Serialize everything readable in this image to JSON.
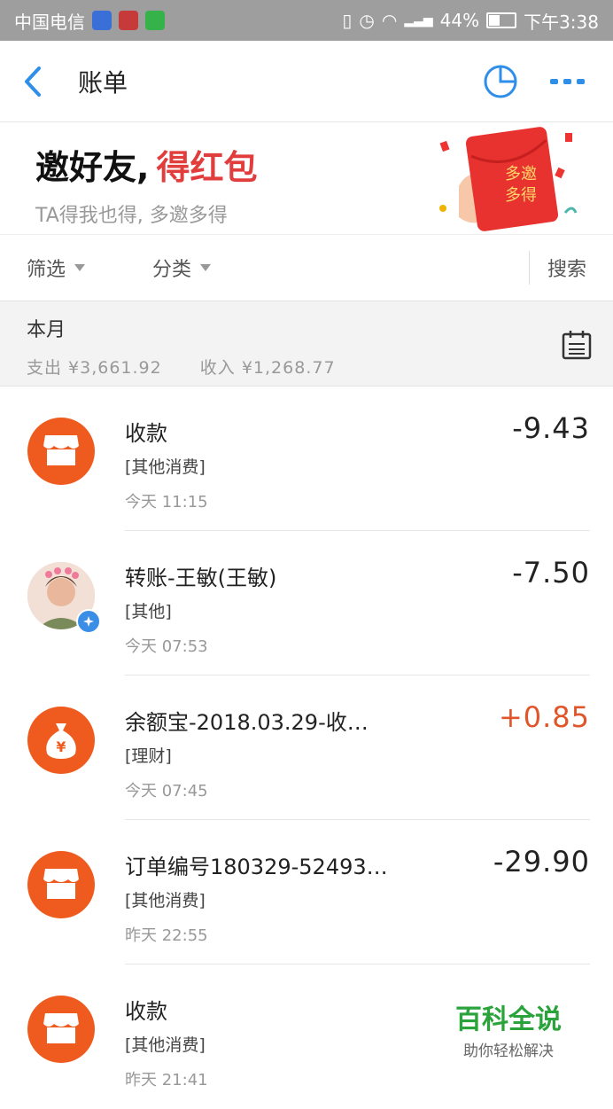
{
  "status_bar": {
    "carrier": "中国电信",
    "battery": "44%",
    "time": "下午3:38"
  },
  "header": {
    "title": "账单"
  },
  "banner": {
    "title_black": "邀好友,",
    "title_red": "得红包",
    "subtitle": "TA得我也得, 多邀多得",
    "art_text_line1": "多邀",
    "art_text_line2": "多得"
  },
  "filters": {
    "filter_label": "筛选",
    "category_label": "分类",
    "search_label": "搜索"
  },
  "month": {
    "title": "本月",
    "expense": "支出 ¥3,661.92",
    "income": "收入 ¥1,268.77"
  },
  "transactions": [
    {
      "name": "收款",
      "category": "[其他消费]",
      "time": "今天  11:15",
      "amount": "-9.43",
      "icon": "store-icon"
    },
    {
      "name": "转账-王敏(王敏)",
      "category": "[其他]",
      "time": "今天  07:53",
      "amount": "-7.50",
      "icon": "avatar-photo"
    },
    {
      "name": "余额宝-2018.03.29-收…",
      "category": "[理财]",
      "time": "今天  07:45",
      "amount": "+0.85",
      "icon": "money-bag-icon"
    },
    {
      "name": "订单编号180329-52493…",
      "category": "[其他消费]",
      "time": "昨天  22:55",
      "amount": "-29.90",
      "icon": "store-icon"
    },
    {
      "name": "收款",
      "category": "[其他消费]",
      "time": "昨天  21:41",
      "amount": "",
      "icon": "store-icon"
    }
  ],
  "watermark": {
    "main": "百科全说",
    "sub": "助你轻松解决"
  },
  "colors": {
    "accent_blue": "#2f8fe8",
    "orange": "#ef5b1e",
    "red": "#e23d3d",
    "positive_amount": "#e0552a"
  }
}
